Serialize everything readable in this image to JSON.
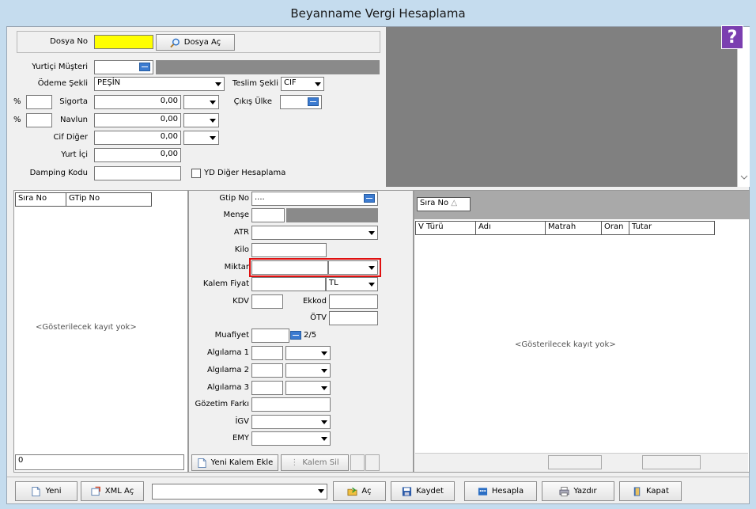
{
  "window": {
    "title": "Beyanname Vergi Hesaplama"
  },
  "form": {
    "dosya_no_label": "Dosya No",
    "dosya_no_value": "",
    "dosya_ac_label": "Dosya Aç",
    "yurtici_musteri_label": "Yurtiçi Müşteri",
    "odeme_sekli_label": "Ödeme Şekli",
    "odeme_sekli_value": "PEŞİN",
    "teslim_sekli_label": "Teslim Şekli",
    "teslim_sekli_value": "CIF",
    "cikis_ulke_label": "Çıkış Ülke",
    "percent_symbol": "%",
    "sigorta_label": "Sigorta",
    "sigorta_value": "0,00",
    "navlun_label": "Navlun",
    "navlun_value": "0,00",
    "cif_diger_label": "Cif Diğer",
    "cif_diger_value": "0,00",
    "yurt_ici_label": "Yurt İçi",
    "yurt_ici_value": "0,00",
    "damping_kodu_label": "Damping Kodu",
    "yd_diger_label": "YD Diğer Hesaplama"
  },
  "left_grid": {
    "columns": [
      "Sıra No",
      "GTip No"
    ],
    "empty_text": "<Gösterilecek kayıt yok>",
    "footer_value": "0"
  },
  "item_form": {
    "gtip_no_label": "Gtip No",
    "gtip_no_value": "....",
    "mense_label": "Menşe",
    "atr_label": "ATR",
    "kilo_label": "Kilo",
    "miktar_label": "Miktar",
    "kalem_fiyat_label": "Kalem Fiyat",
    "currency_value": "TL",
    "kdv_label": "KDV",
    "ekkod_label": "Ekkod",
    "otv_label": "ÖTV",
    "muafiyet_label": "Muafiyet",
    "muafiyet_counter": "2/5",
    "algilama1_label": "Algılama 1",
    "algilama2_label": "Algılama 2",
    "algilama3_label": "Algılama 3",
    "gozetim_farki_label": "Gözetim Farkı",
    "igv_label": "İGV",
    "emy_label": "EMY",
    "yeni_kalem_label": "Yeni Kalem Ekle",
    "kalem_sil_label": "Kalem Sil"
  },
  "right_grid": {
    "group_header": "Sıra No",
    "columns": [
      "V Türü",
      "Adı",
      "Matrah",
      "Oran",
      "Tutar"
    ],
    "empty_text": "<Gösterilecek kayıt yok>"
  },
  "toolbar": {
    "yeni": "Yeni",
    "xml_ac": "XML Aç",
    "ac": "Aç",
    "kaydet": "Kaydet",
    "hesapla": "Hesapla",
    "yazdir": "Yazdır",
    "kapat": "Kapat"
  },
  "help": {
    "symbol": "?"
  },
  "colors": {
    "highlight": "#ffff00",
    "help_bg": "#7b3fb0",
    "red_box": "#e01010"
  }
}
